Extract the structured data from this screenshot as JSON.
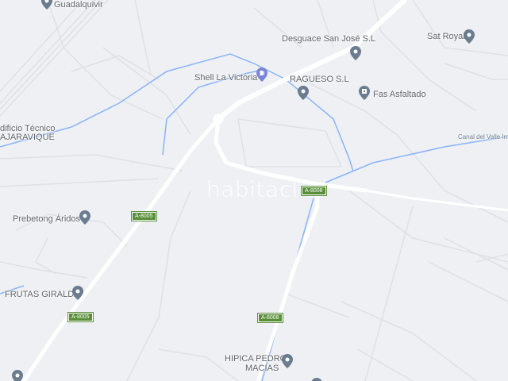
{
  "labels": {
    "guadalquivir": "Guadalquivir",
    "edificio_line1": "dificio Técnico",
    "edificio_line2": "AJARAVIQUE",
    "desguace": "Desguace San José S.L",
    "sat_royal": "Sat Royal",
    "shell": "Shell La Victoria",
    "ragueso": "RAGUESO S.L",
    "fas": "Fas Asfaltado",
    "canal": "Canal del Valle Inf",
    "prebetong": "Prebetong Áridos",
    "frutas": "FRUTAS GIRALDA",
    "hipica_line1": "HIPICA PEDRO",
    "hipica_line2": "MACIAS"
  },
  "road_shields": [
    "A-8008",
    "A-8005",
    "A-8005",
    "A-8008"
  ],
  "watermark": "habitaclia",
  "icons": {
    "location_pin": "location-pin-icon",
    "fuel": "gas-station-icon",
    "business": "business-icon"
  },
  "colors": {
    "background": "#eef0f3",
    "road": "#ffffff",
    "minor_road": "#dde1e6",
    "water": "#8ab4f8",
    "pin": "#6b7c8f",
    "shield": "#5a8f3a"
  }
}
